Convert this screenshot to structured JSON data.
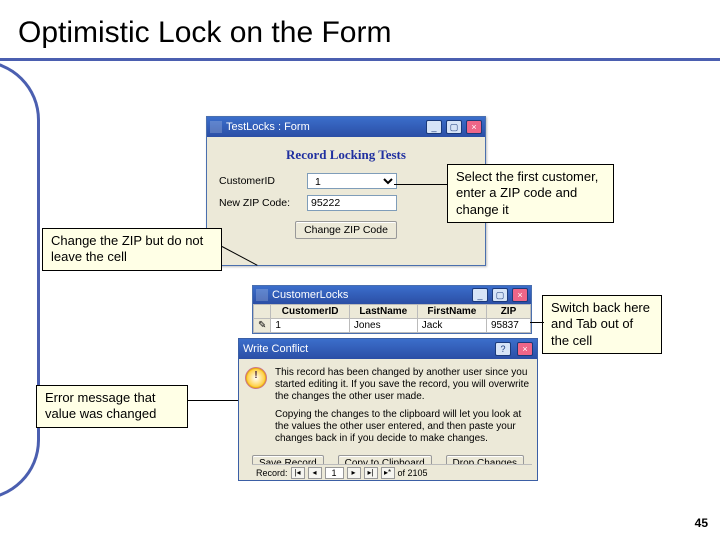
{
  "slide": {
    "title": "Optimistic Lock on the Form",
    "page_number": "45"
  },
  "callouts": {
    "select_first": "Select the first customer, enter a ZIP code and change it",
    "change_zip": "Change the ZIP but do not leave the cell",
    "switch_back": "Switch back here and Tab out of the cell",
    "error_msg": "Error message that value was changed"
  },
  "testlocks_window": {
    "title": "TestLocks : Form",
    "form_title": "Record Locking Tests",
    "customer_label": "CustomerID",
    "customer_value": "1",
    "zip_label": "New ZIP Code:",
    "zip_value": "95222",
    "change_btn": "Change ZIP Code"
  },
  "datasheet_window": {
    "title": "CustomerLocks",
    "columns": [
      "CustomerID",
      "LastName",
      "FirstName",
      "ZIP"
    ],
    "row1": {
      "id": "1",
      "last": "Jones",
      "first": "Jack",
      "zip": "95837"
    },
    "rec_label": "Record:",
    "rec_value": "1",
    "rec_of": "of 2105"
  },
  "dialog": {
    "title": "Write Conflict",
    "para1": "This record has been changed by another user since you started editing it. If you save the record, you will overwrite the changes the other user made.",
    "para2": "Copying the changes to the clipboard will let you look at the values the other user entered, and then paste your changes back in if you decide to make changes.",
    "btn_save": "Save Record",
    "btn_copy": "Copy to Clipboard",
    "btn_drop": "Drop Changes"
  }
}
